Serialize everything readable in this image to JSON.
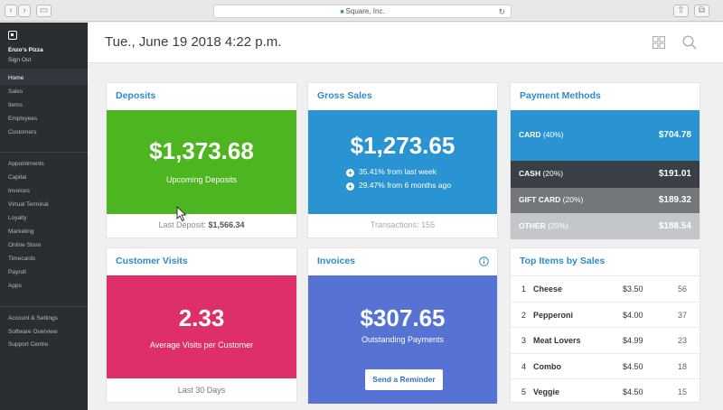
{
  "browser": {
    "url": "Square, Inc."
  },
  "sidebar": {
    "store_name": "Enzo's Pizza",
    "sign_out": "Sign Out",
    "primary_items": [
      "Home",
      "Sales",
      "Items",
      "Employees",
      "Customers"
    ],
    "secondary_items": [
      "Appointments",
      "Capital",
      "Invoices",
      "Virtual Terminal",
      "Loyalty",
      "Marketing",
      "Online Store",
      "Timecards",
      "Payroll",
      "Apps"
    ],
    "tertiary_items": [
      "Account & Settings",
      "Software Overview",
      "Support Centre"
    ],
    "active_item": "Home"
  },
  "header": {
    "date": "Tue., June 19 2018 4:22 p.m."
  },
  "deposits": {
    "title": "Deposits",
    "amount": "$1,373.68",
    "subtitle": "Upcoming Deposits",
    "footer_label": "Last Deposit:",
    "footer_value": "$1,566.34",
    "color": "#4cb51f"
  },
  "gross_sales": {
    "title": "Gross Sales",
    "amount": "$1,273.65",
    "line1": "35.41% from last week",
    "line2": "29.47% from 6 months ago",
    "footer": "Transactions: 155",
    "color": "#2a94d2"
  },
  "payment_methods": {
    "title": "Payment Methods",
    "rows": [
      {
        "label": "CARD",
        "pct": "(40%)",
        "amount": "$704.78",
        "color": "#2a94d2"
      },
      {
        "label": "CASH",
        "pct": "(20%)",
        "amount": "$191.01",
        "color": "#3a3f46"
      },
      {
        "label": "GIFT CARD",
        "pct": "(20%)",
        "amount": "$189.32",
        "color": "#73777c"
      },
      {
        "label": "OTHER",
        "pct": "(20%)",
        "amount": "$188.54",
        "color": "#c3c6ca"
      }
    ]
  },
  "customer_visits": {
    "title": "Customer Visits",
    "amount": "2.33",
    "subtitle": "Average Visits per Customer",
    "footer": "Last 30 Days",
    "color": "#de2f6b"
  },
  "invoices": {
    "title": "Invoices",
    "amount": "$307.65",
    "subtitle": "Outstanding Payments",
    "button": "Send a Reminder",
    "color": "#5673d3"
  },
  "top_items": {
    "title": "Top Items by Sales",
    "rows": [
      {
        "rank": "1",
        "name": "Cheese",
        "price": "$3.50",
        "count": "56"
      },
      {
        "rank": "2",
        "name": "Pepperoni",
        "price": "$4.00",
        "count": "37"
      },
      {
        "rank": "3",
        "name": "Meat Lovers",
        "price": "$4.99",
        "count": "23"
      },
      {
        "rank": "4",
        "name": "Combo",
        "price": "$4.50",
        "count": "18"
      },
      {
        "rank": "5",
        "name": "Veggie",
        "price": "$4.50",
        "count": "15"
      }
    ]
  }
}
